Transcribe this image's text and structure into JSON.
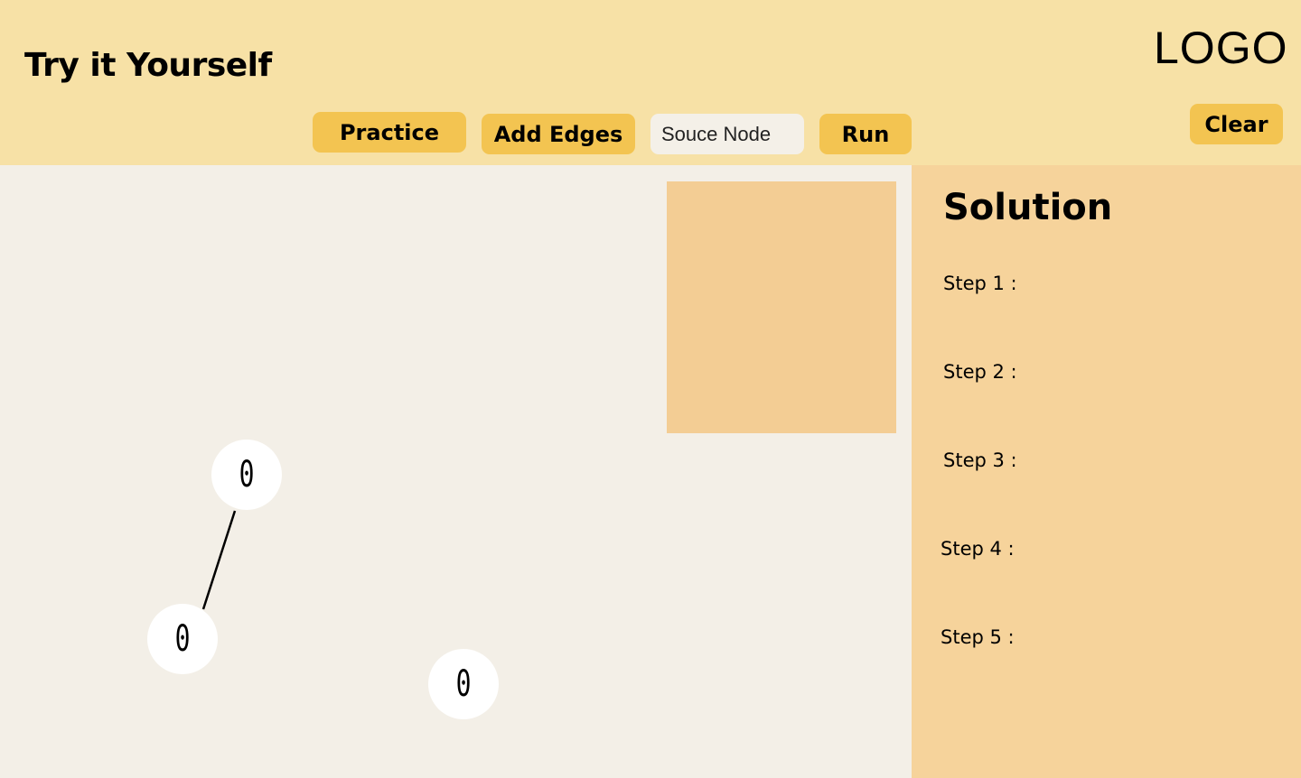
{
  "header": {
    "title": "Try it Yourself",
    "logo": "LOGO",
    "toolbar": {
      "practice_label": "Practice",
      "add_edges_label": "Add Edges",
      "source_node_placeholder": "Souce Node",
      "run_label": "Run",
      "clear_label": "Clear"
    }
  },
  "graph": {
    "nodes": [
      {
        "label": "0"
      },
      {
        "label": "0"
      },
      {
        "label": "0"
      }
    ],
    "edges": [
      {
        "from": 0,
        "to": 1
      }
    ]
  },
  "solution": {
    "title": "Solution",
    "steps": [
      {
        "label": "Step 1 :"
      },
      {
        "label": "Step 2 :"
      },
      {
        "label": "Step 3 :"
      },
      {
        "label": "Step 4 :"
      },
      {
        "label": "Step 5 :"
      }
    ]
  },
  "colors": {
    "header_bg": "#f7e1a6",
    "button_bg": "#f3c451",
    "canvas_bg": "#f3efe7",
    "info_box_bg": "#f3cd94",
    "solution_bg": "#f6d39b",
    "node_bg": "#ffffff"
  }
}
